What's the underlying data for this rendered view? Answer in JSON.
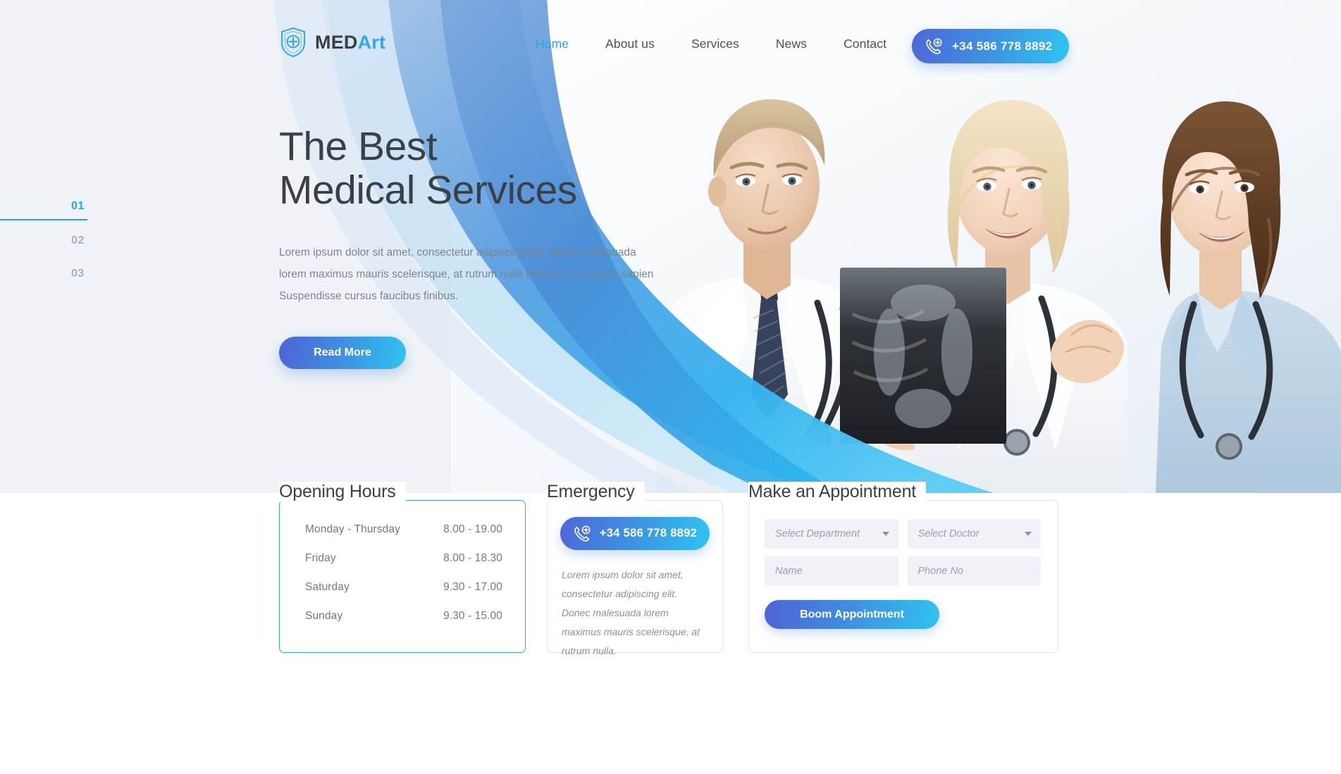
{
  "brand": {
    "name_primary": "MED",
    "name_accent": "Art",
    "logo_icon": "shield-plus-icon"
  },
  "nav": {
    "items": [
      {
        "label": "Home",
        "active": true
      },
      {
        "label": "About us",
        "active": false
      },
      {
        "label": "Services",
        "active": false
      },
      {
        "label": "News",
        "active": false
      },
      {
        "label": "Contact",
        "active": false
      }
    ],
    "phone_button": {
      "label": "+34 586 778 8892",
      "icon": "phone-medical-icon"
    }
  },
  "hero": {
    "title_line1": "The Best",
    "title_line2": "Medical Services",
    "paragraph": "Lorem ipsum dolor sit amet, consectetur adipiscing elit. Donec malesuada lorem maximus mauris scelerisque, at rutrum nulla dictum. Ut ac ligula sapien Suspendisse cursus faucibus finibus.",
    "cta_label": "Read More",
    "slides": [
      {
        "number": "01",
        "active": true
      },
      {
        "number": "02",
        "active": false
      },
      {
        "number": "03",
        "active": false
      }
    ],
    "image_alt": "Three medical professionals reviewing an x-ray film",
    "background_color": "#eff3f7",
    "accent_color": "#2aa3e8"
  },
  "opening_hours": {
    "title": "Opening Hours",
    "rows": [
      {
        "day": "Monday - Thursday",
        "time": "8.00 - 19.00"
      },
      {
        "day": "Friday",
        "time": "8.00 - 18.30"
      },
      {
        "day": "Saturday",
        "time": "9.30 - 17.00"
      },
      {
        "day": "Sunday",
        "time": "9.30 - 15.00"
      }
    ],
    "border_color": "#35a6e0"
  },
  "emergency": {
    "title": "Emergency",
    "phone_label": "+34 586 778 8892",
    "text": "Lorem ipsum dolor sit amet, consectetur adipiscing elit. Donec malesuada lorem maximus mauris scelerisque, at rutrum nulla."
  },
  "appointment": {
    "title": "Make an Appointment",
    "department_placeholder": "Select Department",
    "doctor_placeholder": "Select Doctor",
    "name_placeholder": "Name",
    "phone_placeholder": "Phone No",
    "submit_label": "Boom Appointment"
  }
}
